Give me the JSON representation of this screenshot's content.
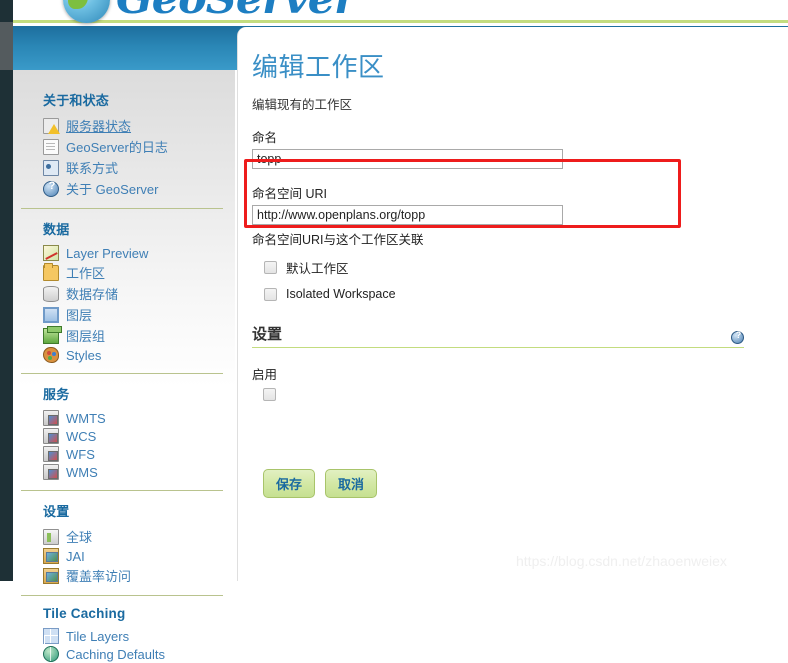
{
  "brand": {
    "logo_text": "GeoServer",
    "logo_icon": "globe-icon"
  },
  "sidebar": {
    "groups": [
      {
        "title": "关于和状态",
        "items": [
          {
            "label": "服务器状态",
            "icon": "status-warning-icon",
            "linked": true
          },
          {
            "label": "GeoServer的日志",
            "icon": "document-icon",
            "linked": false
          },
          {
            "label": "联系方式",
            "icon": "contact-card-icon",
            "linked": false
          },
          {
            "label": "关于 GeoServer",
            "icon": "help-circle-icon",
            "linked": false
          }
        ]
      },
      {
        "title": "数据",
        "items": [
          {
            "label": "Layer Preview",
            "icon": "layer-preview-icon",
            "linked": false
          },
          {
            "label": "工作区",
            "icon": "folder-icon",
            "linked": false
          },
          {
            "label": "数据存储",
            "icon": "database-icon",
            "linked": false
          },
          {
            "label": "图层",
            "icon": "layer-icon",
            "linked": false
          },
          {
            "label": "图层组",
            "icon": "layer-group-icon",
            "linked": false
          },
          {
            "label": "Styles",
            "icon": "palette-icon",
            "linked": false
          }
        ]
      },
      {
        "title": "服务",
        "items": [
          {
            "label": "WMTS",
            "icon": "service-icon",
            "linked": false
          },
          {
            "label": "WCS",
            "icon": "service-icon",
            "linked": false
          },
          {
            "label": "WFS",
            "icon": "service-icon",
            "linked": false
          },
          {
            "label": "WMS",
            "icon": "service-icon",
            "linked": false
          }
        ]
      },
      {
        "title": "设置",
        "items": [
          {
            "label": "全球",
            "icon": "global-settings-icon",
            "linked": false
          },
          {
            "label": "JAI",
            "icon": "jai-icon",
            "linked": false
          },
          {
            "label": "覆盖率访问",
            "icon": "coverage-access-icon",
            "linked": false
          }
        ]
      },
      {
        "title": "Tile Caching",
        "latin": true,
        "items": [
          {
            "label": "Tile Layers",
            "icon": "tile-layers-icon",
            "linked": false
          },
          {
            "label": "Caching Defaults",
            "icon": "caching-defaults-icon",
            "linked": false
          }
        ]
      }
    ]
  },
  "main": {
    "title": "编辑工作区",
    "subtitle": "编辑现有的工作区",
    "name_field": {
      "label": "命名",
      "value": "topp"
    },
    "uri_field": {
      "label": "命名空间 URI",
      "value": "http://www.openplans.org/topp",
      "hint": "命名空间URI与这个工作区关联"
    },
    "checkboxes": [
      {
        "label": "默认工作区",
        "checked": false
      },
      {
        "label": "Isolated Workspace",
        "checked": false
      }
    ],
    "settings_section": {
      "title": "设置",
      "help_icon": "help-circle-icon",
      "enable_label": "启用",
      "enable_checked": false
    },
    "buttons": {
      "save": "保存",
      "cancel": "取消"
    }
  },
  "annotation": {
    "highlight_color": "#ee1c1c"
  },
  "watermark": {
    "text": "https://blog.csdn.net/zhaoenweiex"
  }
}
